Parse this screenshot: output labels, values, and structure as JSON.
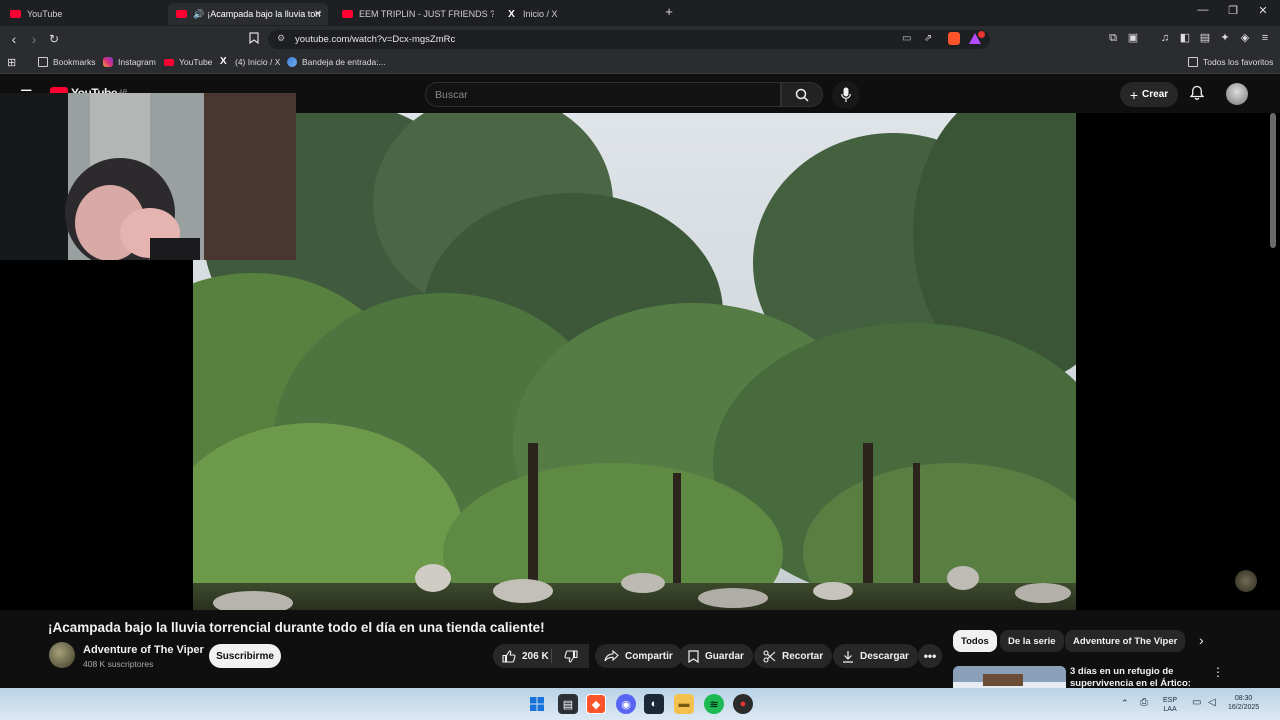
{
  "browser": {
    "tabs": [
      {
        "label": "YouTube",
        "icon": "youtube-icon"
      },
      {
        "label": "¡Acampada bajo la lluvia torrencial durante todo el día en una tienda caliente!",
        "display": "¡Acampada bajo la lluvia torr",
        "icon": "youtube-icon",
        "active": true
      },
      {
        "label": "EEM TRIPLIN - JUST FRIENDS ? (OFFI",
        "icon": "youtube-icon"
      },
      {
        "label": "Inicio / X",
        "icon": "x-icon"
      }
    ],
    "url": "youtube.com/watch?v=Dcx-mgsZmRc",
    "bookmarks": [
      {
        "label": "Bookmarks",
        "icon": "folder-icon"
      },
      {
        "label": "Instagram",
        "icon": "instagram-icon"
      },
      {
        "label": "YouTube",
        "icon": "youtube-icon"
      },
      {
        "label": "(4) Inicio / X",
        "icon": "x-icon"
      },
      {
        "label": "Bandeja de entrada:...",
        "icon": "mail-icon"
      }
    ],
    "all_bookmarks": "Todos los favoritos"
  },
  "youtube": {
    "logo": "YouTube",
    "region": "AR",
    "search_placeholder": "Buscar",
    "create_label": "Crear",
    "video": {
      "title": "¡Acampada bajo la lluvia torrencial durante todo el día en una tienda caliente!",
      "channel": "Adventure of The Viper",
      "subscribers": "408 K suscriptores",
      "subscribe_label": "Suscribirme",
      "likes": "206 K",
      "share_label": "Compartir",
      "save_label": "Guardar",
      "clip_label": "Recortar",
      "download_label": "Descargar"
    },
    "chips": [
      "Todos",
      "De la serie",
      "Adventure of The Viper"
    ],
    "recommendation": {
      "title_line1": "3 días en un refugio de",
      "title_line2": "supervivencia en el Ártico:"
    }
  },
  "taskbar": {
    "lang": "ESP",
    "lang2": "LAA",
    "time": "08:30",
    "date": "16/2/2025"
  },
  "colors": {
    "brand_red": "#ff0033",
    "background": "#0f0f0f",
    "surface": "#272727"
  }
}
